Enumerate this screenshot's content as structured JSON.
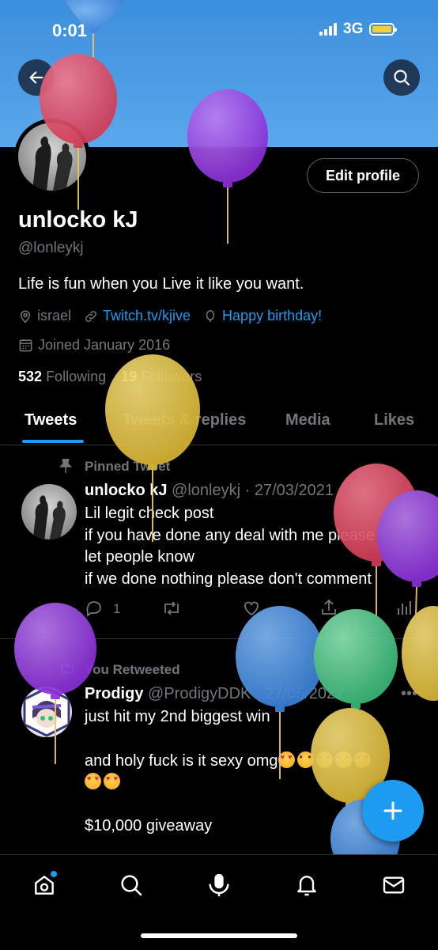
{
  "status_bar": {
    "time": "0:01",
    "network": "3G"
  },
  "profile": {
    "name": "unlocko kJ",
    "handle": "@lonleykj",
    "bio": "Life is fun when you Live it like you want.",
    "location": "israel",
    "website": "Twitch.tv/kjive",
    "birthday_label": "Happy birthday!",
    "joined": "Joined January 2016",
    "edit_button": "Edit profile",
    "following_count": "532",
    "following_label": "Following",
    "followers_count": "19",
    "followers_label": "Followers"
  },
  "tabs": [
    {
      "label": "Tweets",
      "active": true
    },
    {
      "label": "Tweets & replies"
    },
    {
      "label": "Media"
    },
    {
      "label": "Likes"
    }
  ],
  "tweets": [
    {
      "context": "Pinned Tweet",
      "author": "unlocko kJ",
      "handle": "@lonleykj",
      "date": "27/03/2021",
      "lines": [
        "Lil legit check post",
        "if you have done any deal with me please",
        "let people know",
        "if we done nothing please don't comment"
      ],
      "reply_count": "1"
    },
    {
      "context": "You Retweeted",
      "author": "Prodigy",
      "handle": "@ProdigyDDK",
      "date": "27/05/2022",
      "line1": "just hit my 2nd biggest win",
      "line2": "and holy fuck is it sexy omg",
      "line3": "$10,000 giveaway"
    }
  ],
  "icons": {
    "back": "arrow-left-icon",
    "search": "search-icon",
    "compose": "plus-icon",
    "nav": [
      "home-icon",
      "explore-icon",
      "spaces-icon",
      "notifications-icon",
      "messages-icon"
    ]
  },
  "colors": {
    "accent": "#1d9bf0",
    "banner": "#4a9be4",
    "background": "#000000"
  }
}
